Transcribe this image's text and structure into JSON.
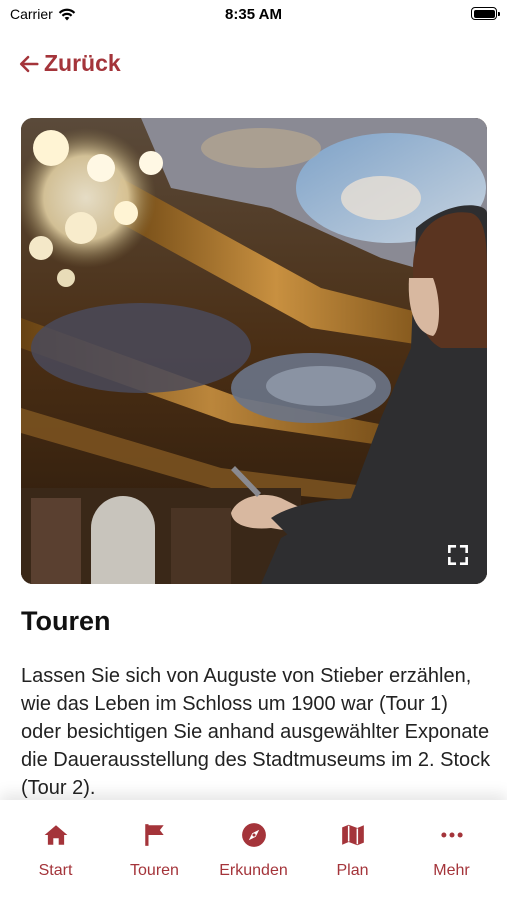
{
  "status_bar": {
    "carrier": "Carrier",
    "time": "8:35 AM"
  },
  "nav": {
    "back_label": "Zurück"
  },
  "content": {
    "title": "Touren",
    "description": "Lassen Sie sich von Auguste von Stieber erzählen, wie das Leben im Schloss um 1900 war (Tour 1) oder besichtigen Sie anhand ausgewählter Exponate die Dauerausstellung des Stadtmuseums im 2. Stock (Tour 2)."
  },
  "tabs": [
    {
      "label": "Start",
      "icon": "home-icon"
    },
    {
      "label": "Touren",
      "icon": "flag-icon"
    },
    {
      "label": "Erkunden",
      "icon": "compass-icon"
    },
    {
      "label": "Plan",
      "icon": "map-icon"
    },
    {
      "label": "Mehr",
      "icon": "more-icon"
    }
  ],
  "colors": {
    "accent": "#a4343a",
    "text": "#111111"
  }
}
